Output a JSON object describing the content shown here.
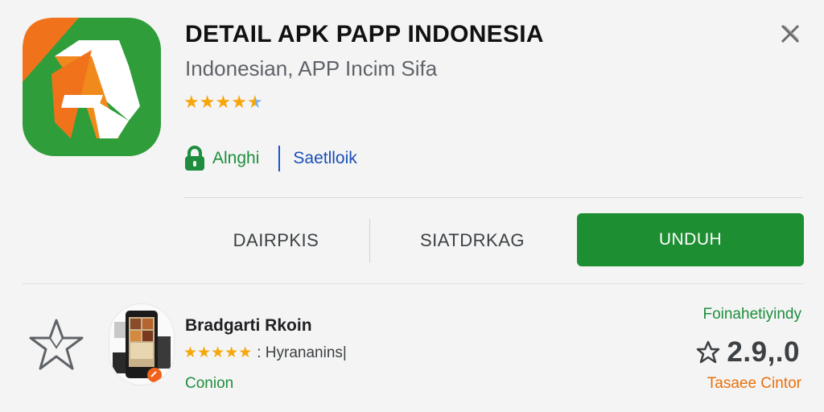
{
  "app": {
    "title": "DETAIL APK PAPP INDONESIA",
    "subtitle": "Indonesian, APP Incim Sifa",
    "rating_stars": 4.5,
    "icon": "app-logo-icon",
    "colors": {
      "brand_green": "#1e8e32",
      "brand_orange": "#f08a1c",
      "star": "#f6a609"
    }
  },
  "meta": {
    "lock_icon": "lock-icon",
    "left_label": "Alnghi",
    "right_label": "Saetlloik"
  },
  "actions": {
    "left": "DAIRPKIS",
    "middle": "SIATDRKAG",
    "primary": "UNDUH"
  },
  "close_icon": "close-icon",
  "item": {
    "favorite_icon": "star-outline-icon",
    "title": "Bradgarti Rkoin",
    "stars": 5,
    "reviews": ": Hyrananins|",
    "tag": "Conion",
    "side_label": "Foinahetiyindy",
    "score": "2.9,.0",
    "side_sub": "Tasaee Cintor"
  }
}
